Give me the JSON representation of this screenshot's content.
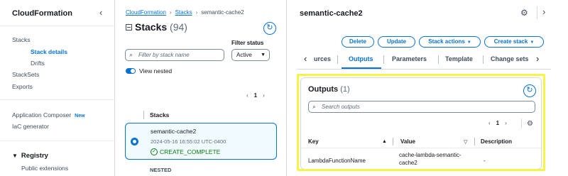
{
  "nav": {
    "title": "CloudFormation",
    "items": [
      "Stacks",
      "Stack details",
      "Drifts",
      "StackSets",
      "Exports"
    ],
    "composer_label": "Application Composer",
    "composer_badge": "New",
    "iac_generator": "IaC generator",
    "registry_section": "Registry",
    "registry_item_cutoff": "Public extensions"
  },
  "breadcrumb": {
    "root": "CloudFormation",
    "mid": "Stacks",
    "current": "semantic-cache2"
  },
  "stacks_panel": {
    "heading": "Stacks",
    "count": "(94)",
    "filter_status_label": "Filter status",
    "search_placeholder": "Filter by stack name",
    "status_selected": "Active",
    "view_nested_label": "View nested",
    "page": "1",
    "column_header": "Stacks",
    "selected_stack": {
      "name": "semantic-cache2",
      "timestamp": "2024-05-16 16:55:02 UTC-0400",
      "status": "CREATE_COMPLETE"
    },
    "next_row_label": "NESTED"
  },
  "detail_panel": {
    "title": "semantic-cache2",
    "actions": {
      "delete": "Delete",
      "update": "Update",
      "stack_actions": "Stack actions",
      "create_stack": "Create stack"
    },
    "tabs": [
      "urces",
      "Outputs",
      "Parameters",
      "Template",
      "Change sets"
    ],
    "active_tab": "Outputs"
  },
  "outputs": {
    "title": "Outputs",
    "count": "(1)",
    "search_placeholder": "Search outputs",
    "page": "1",
    "columns": {
      "key": "Key",
      "value": "Value",
      "description": "Description"
    },
    "rows": [
      {
        "key": "LambdaFunctionName",
        "value_line1": "cache-lambda-semantic-",
        "value_line2": "cache2",
        "description": "-"
      }
    ]
  },
  "colors": {
    "accent": "#0972d3",
    "success": "#037f0c",
    "highlight": "#f5f547"
  }
}
